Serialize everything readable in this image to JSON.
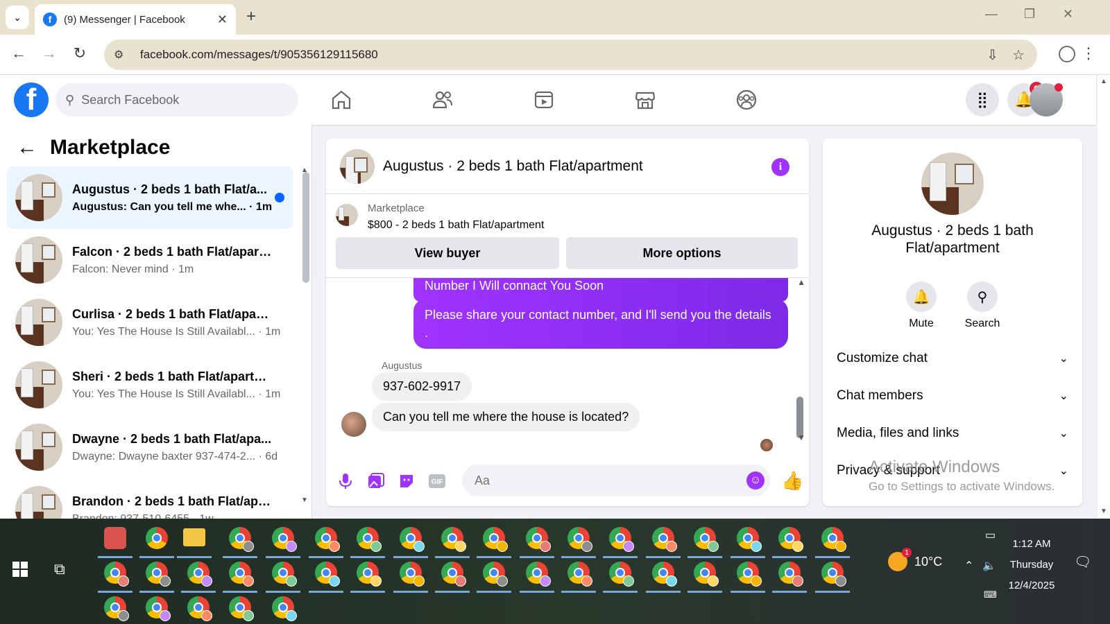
{
  "browser": {
    "tab_title": "(9) Messenger | Facebook",
    "url": "facebook.com/messages/t/905356129115680"
  },
  "fb": {
    "search_placeholder": "Search Facebook",
    "notifications_count": "9"
  },
  "left": {
    "title": "Marketplace",
    "conversations": [
      {
        "name": "Augustus · 2 beds 1 bath Flat/a...",
        "snippet": "Augustus: Can you tell me whe... · 1m",
        "active": true
      },
      {
        "name": "Falcon · 2 beds 1 bath Flat/apart...",
        "snippet": "Falcon: Never mind · 1m"
      },
      {
        "name": "Curlisa · 2 beds 1 bath Flat/apart...",
        "snippet": "You: Yes The House Is Still Availabl... · 1m"
      },
      {
        "name": "Sheri · 2 beds 1 bath Flat/apartm...",
        "snippet": "You: Yes The House Is Still Availabl... · 1m"
      },
      {
        "name": "Dwayne · 2 beds 1 bath Flat/apa...",
        "snippet": "Dwayne: Dwayne baxter 937-474-2... · 6d"
      },
      {
        "name": "Brandon · 2 beds 1 bath Flat/apa...",
        "snippet": "Brandon: 937-510-6455 · 1w"
      }
    ]
  },
  "chat": {
    "title": "Augustus · 2 beds 1 bath Flat/apartment",
    "marketplace_label": "Marketplace",
    "listing": "$800 - 2 beds 1 bath Flat/apartment",
    "view_buyer": "View buyer",
    "more_options": "More options",
    "out_msg_1": "Number I Will connact You Soon",
    "out_msg_2": "Please share your contact number, and I'll send you the details .",
    "sender": "Augustus",
    "in_msg_1": "937-602-9917",
    "in_msg_2": "Can you tell me where the house is located?",
    "composer_placeholder": "Aa"
  },
  "right": {
    "name": "Augustus · 2 beds 1 bath Flat/apartment",
    "mute": "Mute",
    "search": "Search",
    "customize": "Customize chat",
    "members": "Chat members",
    "media": "Media, files and links",
    "privacy": "Privacy & support"
  },
  "watermark": {
    "line1": "Activate Windows",
    "line2": "Go to Settings to activate Windows."
  },
  "taskbar": {
    "temperature": "10°C",
    "time": "1:12 AM",
    "day": "Thursday",
    "date": "12/4/2025"
  },
  "colors": {
    "facebook_blue": "#1877f2",
    "messenger_purple": "#a033ff",
    "notification_red": "#e41e3f"
  }
}
